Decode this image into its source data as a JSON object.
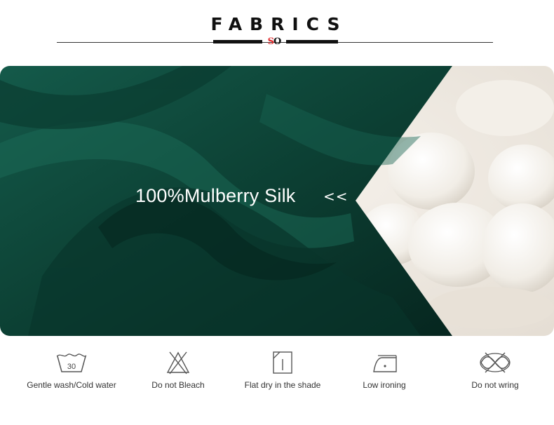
{
  "header": {
    "title": "FABRICS",
    "logo": {
      "letter1": "S",
      "letter2": "O"
    }
  },
  "banner": {
    "headline": "100%Mulberry Silk",
    "arrows": "<<",
    "colors": {
      "silk": "#0f4a3c",
      "silk_dark": "#062a22",
      "cocoon_bg": "#efe9e1"
    }
  },
  "care": [
    {
      "icon": "wash-30-icon",
      "label": "Gentle wash/Cold water",
      "wash_temp": "30"
    },
    {
      "icon": "no-bleach-icon",
      "label": "Do not Bleach"
    },
    {
      "icon": "flat-dry-shade-icon",
      "label": "Flat dry in the shade"
    },
    {
      "icon": "low-iron-icon",
      "label": "Low ironing"
    },
    {
      "icon": "no-wring-icon",
      "label": "Do not wring"
    }
  ]
}
